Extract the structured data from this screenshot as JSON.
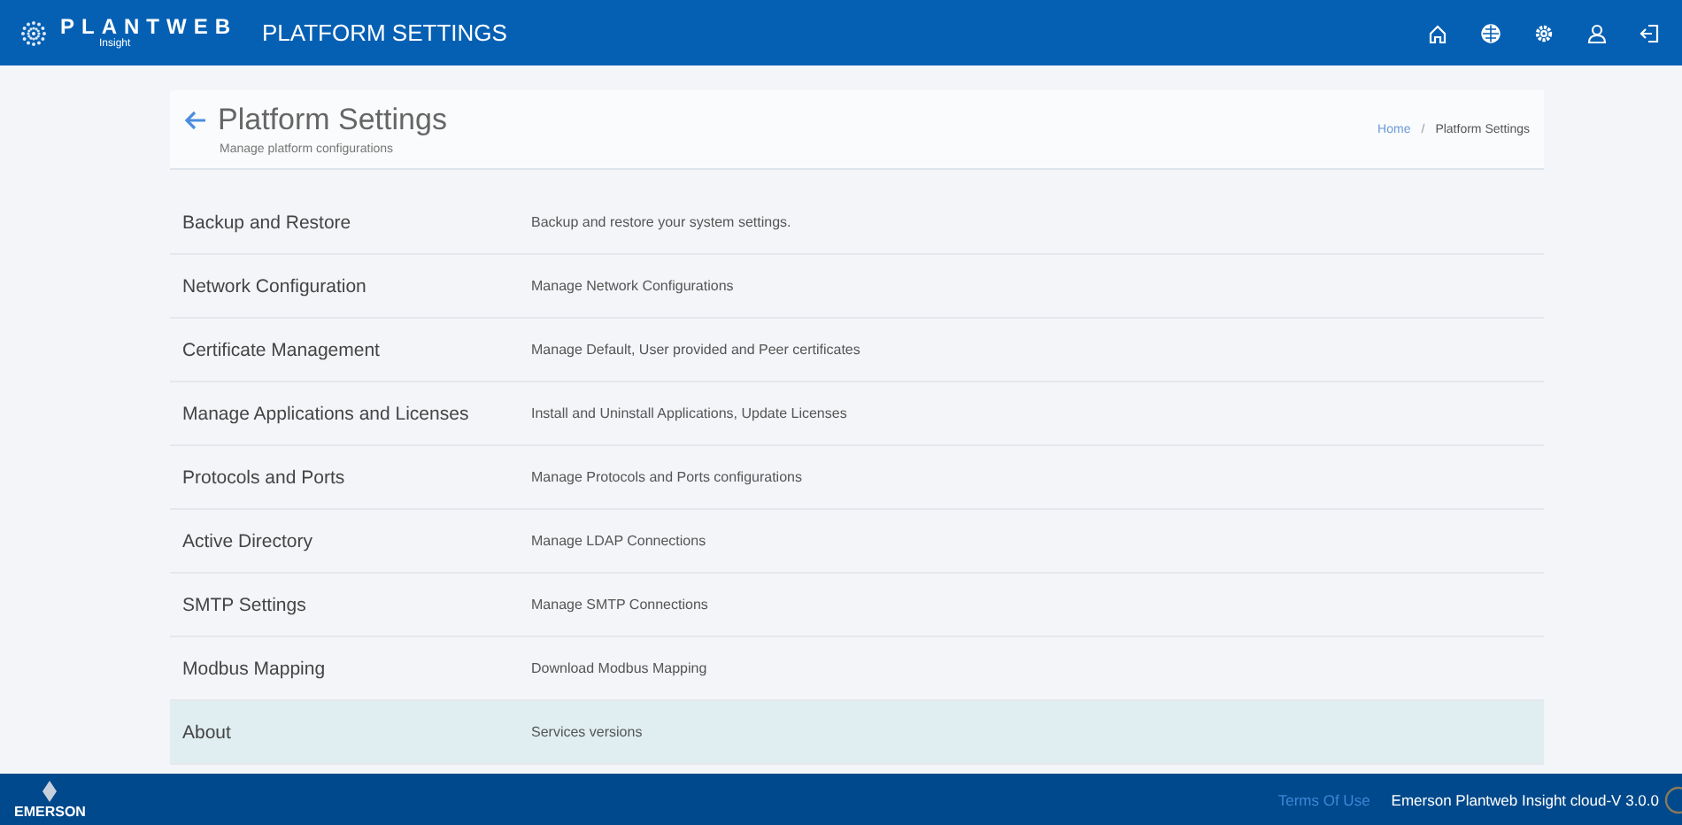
{
  "header": {
    "brand": "PLANTWEB",
    "brand_sub": "Insight",
    "title": "PLATFORM SETTINGS"
  },
  "page": {
    "title": "Platform Settings",
    "subtitle": "Manage platform configurations",
    "breadcrumb": [
      {
        "label": "Home",
        "kind": "link"
      },
      {
        "label": "/",
        "kind": "separator"
      },
      {
        "label": "Platform Settings",
        "kind": "current"
      }
    ]
  },
  "settings": [
    {
      "name": "Backup and Restore",
      "description": "Backup and restore your system settings.",
      "selected": false
    },
    {
      "name": "Network Configuration",
      "description": "Manage Network Configurations",
      "selected": false
    },
    {
      "name": "Certificate Management",
      "description": "Manage Default, User provided and Peer certificates",
      "selected": false
    },
    {
      "name": "Manage Applications and Licenses",
      "description": "Install and Uninstall Applications, Update Licenses",
      "selected": false
    },
    {
      "name": "Protocols and Ports",
      "description": "Manage Protocols and Ports configurations",
      "selected": false
    },
    {
      "name": "Active Directory",
      "description": "Manage LDAP Connections",
      "selected": false
    },
    {
      "name": "SMTP Settings",
      "description": "Manage SMTP Connections",
      "selected": false
    },
    {
      "name": "Modbus Mapping",
      "description": "Download Modbus Mapping",
      "selected": false
    },
    {
      "name": "About",
      "description": "Services versions",
      "selected": true
    }
  ],
  "footer": {
    "logo": "EMERSON",
    "terms": "Terms Of Use",
    "version": "Emerson Plantweb Insight cloud-V 3.0.0"
  }
}
